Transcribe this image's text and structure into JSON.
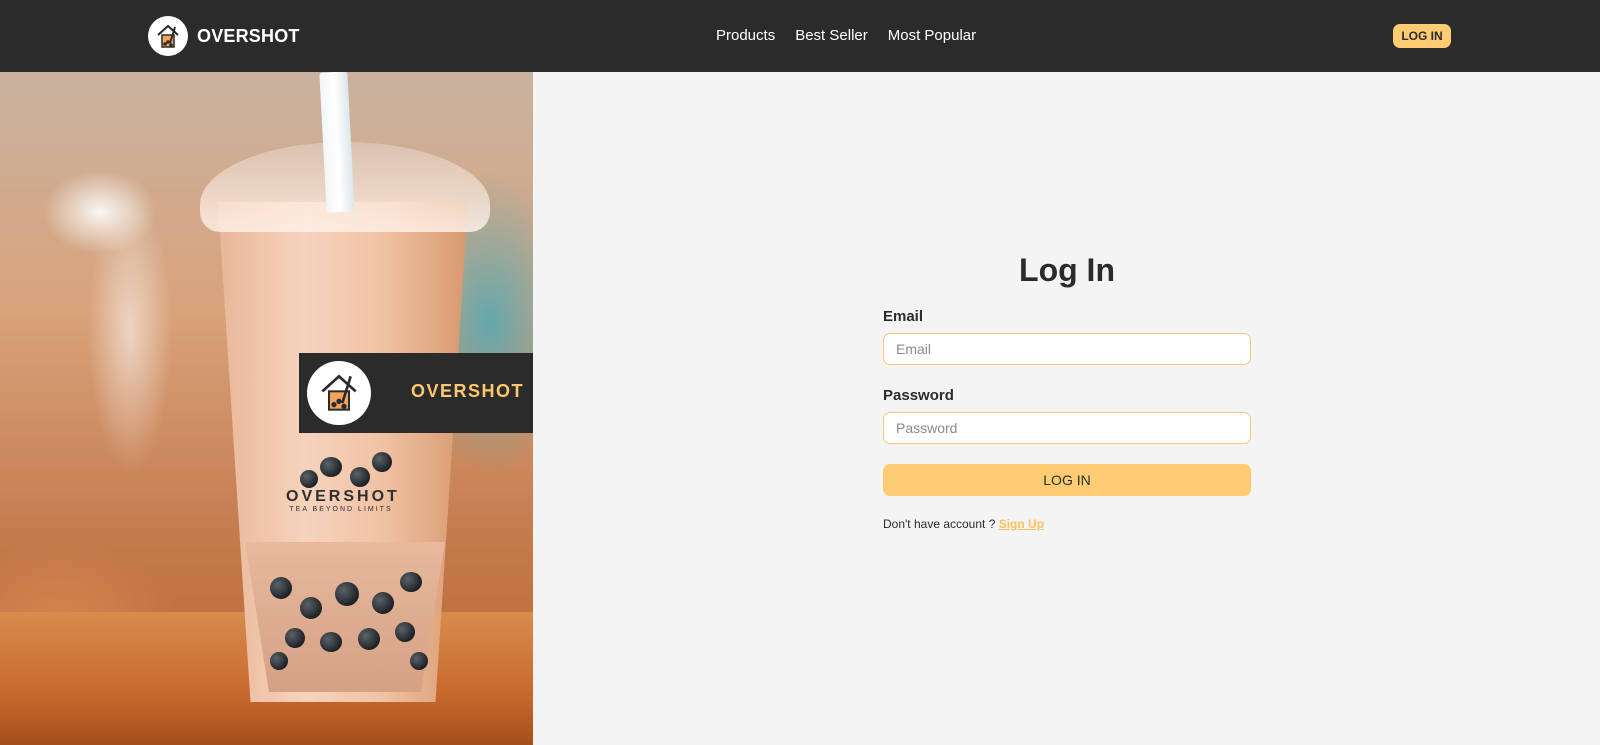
{
  "header": {
    "brand_name": "OVERSHOT",
    "nav": [
      {
        "label": "Products"
      },
      {
        "label": "Best Seller"
      },
      {
        "label": "Most Popular"
      }
    ],
    "login_label": "LOG IN"
  },
  "hero": {
    "banner_name": "OVERSHOT",
    "cup_print_word": "OVERSHOT",
    "cup_print_sub": "TEA BEYOND LIMITS",
    "logo_icon": "bubble-tea-house-logo"
  },
  "form": {
    "title": "Log In",
    "email_label": "Email",
    "email_placeholder": "Email",
    "email_value": "",
    "password_label": "Password",
    "password_placeholder": "Password",
    "password_value": "",
    "submit_label": "LOG IN",
    "signup_prompt": "Don't have account ?",
    "signup_link": "Sign Up"
  },
  "colors": {
    "header_bg": "#2b2b2b",
    "accent": "#ffcc73",
    "page_bg": "#f4f4f4",
    "text": "#2b2b2b"
  }
}
